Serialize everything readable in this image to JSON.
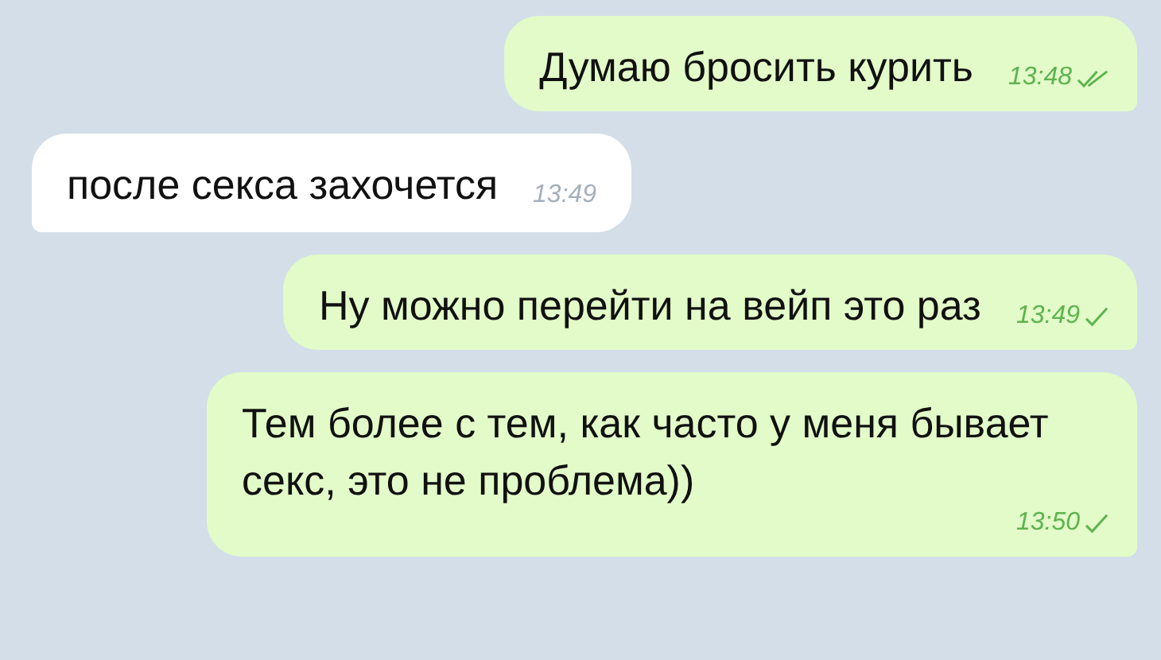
{
  "messages": [
    {
      "kind": "outgoing",
      "text": "Думаю бросить курить",
      "time": "13:48",
      "read": true
    },
    {
      "kind": "incoming",
      "text": "после секса захочется",
      "time": "13:49"
    },
    {
      "kind": "outgoing",
      "text": "Ну можно перейти на вейп это раз",
      "time": "13:49",
      "read": false
    },
    {
      "kind": "outgoing",
      "text": "Тем более с тем, как часто у меня бывает секс, это не проблема))",
      "time": "13:50",
      "read": false
    }
  ]
}
